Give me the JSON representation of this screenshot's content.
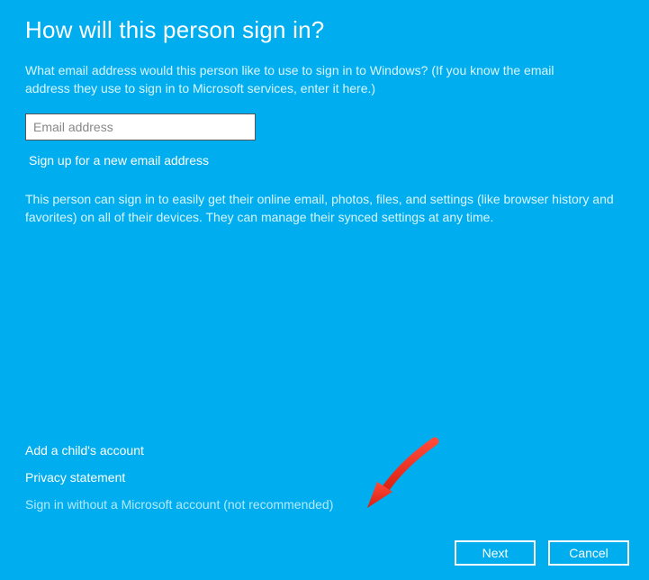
{
  "title": "How will this person sign in?",
  "description": "What email address would this person like to use to sign in to Windows? (If you know the email address they use to sign in to Microsoft services, enter it here.)",
  "email_placeholder": "Email address",
  "signup_link": "Sign up for a new email address",
  "info": "This person can sign in to easily get their online email, photos, files, and settings (like browser history and favorites) on all of their devices. They can manage their synced settings at any time.",
  "links": {
    "add_child": "Add a child's account",
    "privacy": "Privacy statement",
    "no_ms_account": "Sign in without a Microsoft account (not recommended)"
  },
  "buttons": {
    "next": "Next",
    "cancel": "Cancel"
  }
}
